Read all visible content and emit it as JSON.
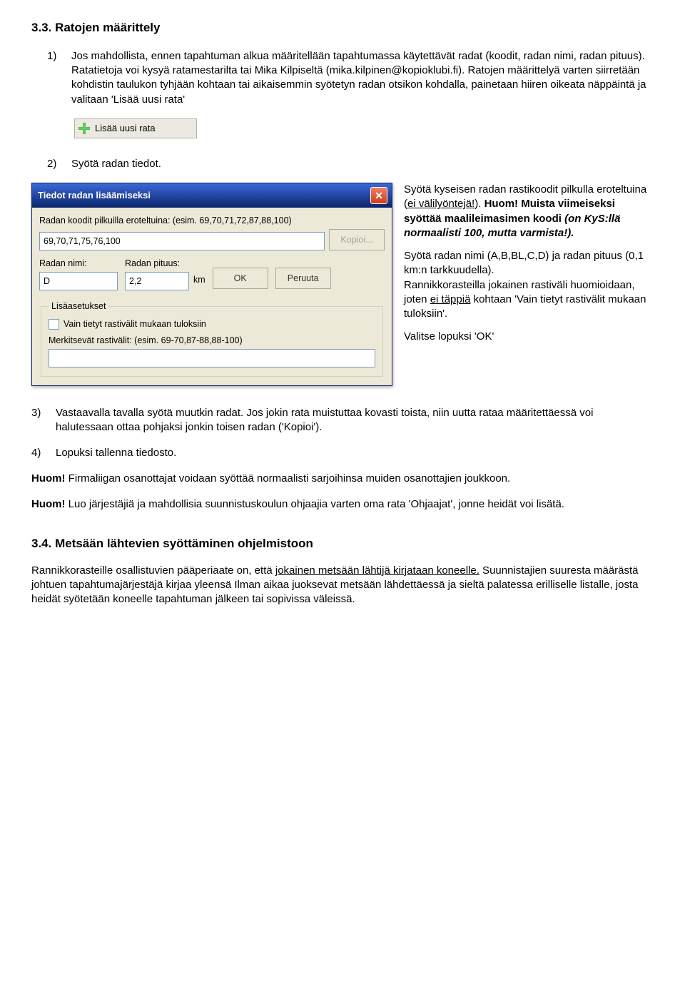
{
  "section1_title": "3.3. Ratojen määrittely",
  "items": {
    "n1": "1)",
    "t1_a": "Jos mahdollista, ennen tapahtuman alkua määritellään tapahtumassa käytettävät radat (koodit, radan nimi, radan pituus). Ratatietoja voi kysyä ratamestarilta tai Mika Kilpiseltä (mika.kilpinen@kopioklubi.fi). Ratojen määrittelyä varten siirretään kohdistin taulukon tyhjään kohtaan tai aikaisemmin syötetyn radan otsikon kohdalla, painetaan hiiren oikeata näppäintä ja valitaan 'Lisää uusi rata'",
    "add_label": "Lisää uusi rata",
    "n2": "2)",
    "t2": "Syötä radan tiedot.",
    "n3": "3)",
    "t3": "Vastaavalla tavalla syötä muutkin radat. Jos jokin rata muistuttaa kovasti toista, niin uutta rataa määritettäessä voi halutessaan ottaa pohjaksi jonkin toisen radan ('Kopioi').",
    "n4": "4)",
    "t4": "Lopuksi tallenna tiedosto."
  },
  "dialog": {
    "title": "Tiedot radan lisäämiseksi",
    "koodit_label": "Radan koodit pilkuilla eroteltuina: (esim. 69,70,71,72,87,88,100)",
    "koodit_value": "69,70,71,75,76,100",
    "kopioi": "Kopioi...",
    "nimi_label": "Radan nimi:",
    "nimi_value": "D",
    "pituus_label": "Radan pituus:",
    "pituus_value": "2,2",
    "km": "km",
    "ok": "OK",
    "peruuta": "Peruuta",
    "lisaasetukset": "Lisäasetukset",
    "chk_label": "Vain tietyt rastivälit mukaan tuloksiin",
    "merk_label": "Merkitsevät rastivälit: (esim. 69-70,87-88,88-100)"
  },
  "side": {
    "p1_a": "Syötä kyseisen radan rastikoodit pilkulla eroteltuina (",
    "p1_u1": "ei välilyöntejä!",
    "p1_b": "). ",
    "p1_huom": "Huom!",
    "p1_bold": " Muista viimeiseksi syöttää maalileimasimen koodi ",
    "p1_ital": "(on KyS:llä normaalisti 100, mutta varmista!).",
    "p2_a": "Syötä radan nimi (A,B,BL,C,D) ja radan pituus (0,1 km:n tarkkuudella).",
    "p2_b1": "Rannikkorasteilla jokainen rastiväli huomioidaan, joten ",
    "p2_u": "ei täppiä",
    "p2_b2": " kohtaan 'Vain tietyt rastivälit mukaan tuloksiin'.",
    "p3": "Valitse lopuksi 'OK'"
  },
  "huom1_b": "Huom!",
  "huom1": " Firmaliigan osanottajat voidaan syöttää normaalisti sarjoihinsa muiden osanottajien joukkoon.",
  "huom2_b": "Huom!",
  "huom2": " Luo järjestäjiä ja mahdollisia suunnistuskoulun ohjaajia varten oma rata 'Ohjaajat', jonne heidät voi lisätä.",
  "section2_title": "3.4. Metsään lähtevien syöttäminen ohjelmistoon",
  "para2_a": "Rannikkorasteille osallistuvien pääperiaate on, että ",
  "para2_u": "jokainen metsään lähtijä kirjataan koneelle.",
  "para2_b": " Suunnistajien suuresta määrästä johtuen tapahtumajärjestäjä kirjaa yleensä Ilman aikaa juoksevat metsään lähdettäessä ja sieltä palatessa erilliselle listalle, josta heidät syötetään koneelle tapahtuman jälkeen tai sopivissa väleissä."
}
